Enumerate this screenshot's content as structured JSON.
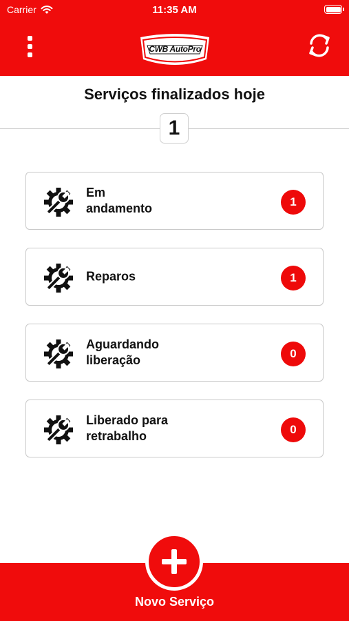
{
  "status_bar": {
    "carrier": "Carrier",
    "time": "11:35 AM"
  },
  "header": {
    "logo_text": "CWB AutoPro"
  },
  "summary": {
    "title": "Serviços finalizados hoje",
    "count": "1"
  },
  "cards": [
    {
      "label_line1": "Em",
      "label_line2": "andamento",
      "count": "1"
    },
    {
      "label_line1": "Reparos",
      "label_line2": "",
      "count": "1"
    },
    {
      "label_line1": "Aguardando",
      "label_line2": "liberação",
      "count": "0"
    },
    {
      "label_line1": "Liberado para",
      "label_line2": "retrabalho",
      "count": "0"
    }
  ],
  "footer": {
    "new_service_label": "Novo Serviço"
  },
  "colors": {
    "brand": "#f00c0c",
    "badge": "#ee0a0a"
  },
  "icons": {
    "menu": "more-vertical-icon",
    "refresh": "refresh-icon",
    "card": "gear-wrench-icon",
    "add": "plus-icon"
  }
}
